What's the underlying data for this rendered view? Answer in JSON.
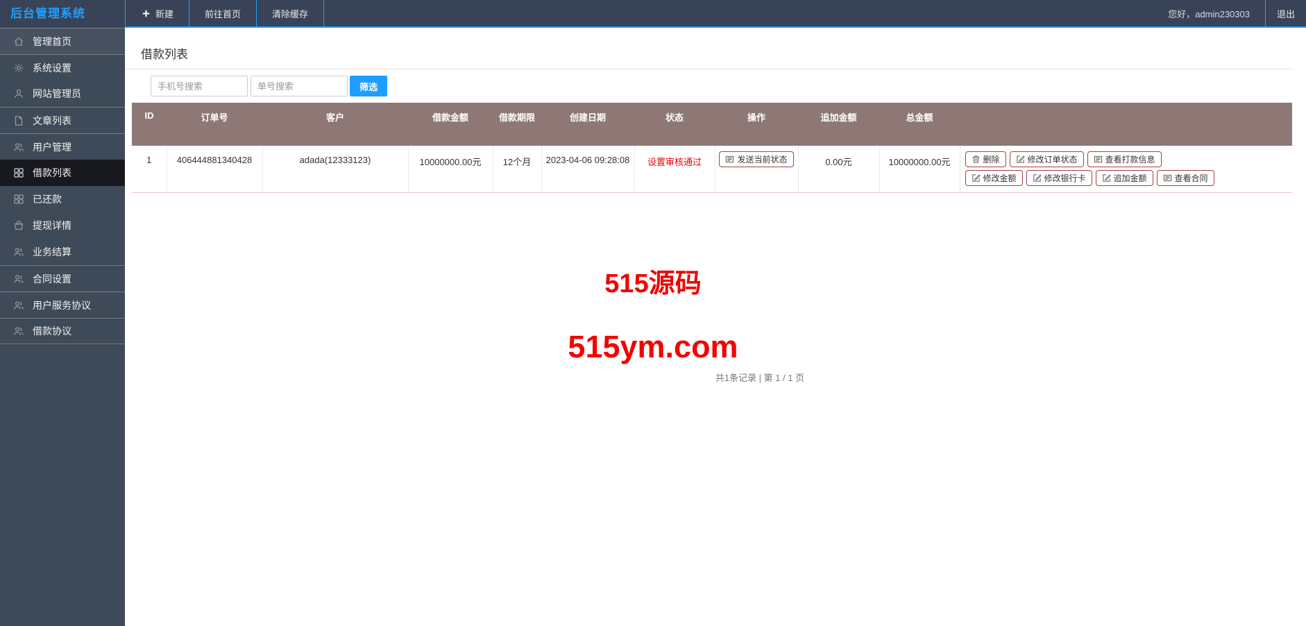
{
  "topbar": {
    "logo": "后台管理系统",
    "nav": [
      {
        "label": "新建",
        "icon": "plus-icon"
      },
      {
        "label": "前往首页"
      },
      {
        "label": "清除缓存"
      }
    ],
    "greeting": "您好，admin230303",
    "logout": "退出"
  },
  "sidebar": {
    "items": [
      {
        "label": "管理首页",
        "icon": "home-icon"
      },
      {
        "label": "系统设置",
        "icon": "gear-icon"
      },
      {
        "label": "网站管理员",
        "icon": "user-icon"
      },
      {
        "label": "文章列表",
        "icon": "document-icon"
      },
      {
        "label": "用户管理",
        "icon": "users-icon"
      },
      {
        "label": "借款列表",
        "icon": "grid-icon",
        "active": true
      },
      {
        "label": "已还款",
        "icon": "grid-icon"
      },
      {
        "label": "提现详情",
        "icon": "bag-icon"
      },
      {
        "label": "业务结算",
        "icon": "users-icon"
      },
      {
        "label": "合同设置",
        "icon": "users-icon"
      },
      {
        "label": "用户服务协议",
        "icon": "users-icon"
      },
      {
        "label": "借款协议",
        "icon": "users-icon"
      }
    ]
  },
  "page": {
    "title": "借款列表",
    "filters": {
      "phone_placeholder": "手机号搜索",
      "order_placeholder": "单号搜索",
      "filter_button": "筛选"
    },
    "table": {
      "headers": [
        "ID",
        "订单号",
        "客户",
        "借款金额",
        "借款期限",
        "创建日期",
        "状态",
        "操作",
        "追加金额",
        "总金额",
        ""
      ],
      "row": {
        "id": "1",
        "order_no": "406444881340428",
        "customer": "adada(12333123)",
        "loan_amount": "10000000.00元",
        "loan_term": "12个月",
        "created_at": "2023-04-06 09:28:08",
        "status": "设置审核通过",
        "operation_button": "发送当前状态",
        "extra_amount": "0.00元",
        "total_amount": "10000000.00元",
        "actions": [
          {
            "label": "删除",
            "icon": "trash-icon"
          },
          {
            "label": "修改订单状态",
            "icon": "edit-icon"
          },
          {
            "label": "查看打款信息",
            "icon": "list-icon"
          },
          {
            "label": "修改金额",
            "icon": "edit-icon"
          },
          {
            "label": "修改银行卡",
            "icon": "edit-icon"
          },
          {
            "label": "追加金额",
            "icon": "edit-icon"
          },
          {
            "label": "查看合同",
            "icon": "list-icon"
          }
        ]
      }
    },
    "pagination": "共1条记录 | 第 1 / 1 页"
  },
  "watermark": {
    "line1": "515源码",
    "line2": "515ym.com"
  },
  "colors": {
    "accent_blue": "#1e9fff",
    "table_header": "#8d7876",
    "action_button_border": "#a54040",
    "status_red": "#ee0000",
    "watermark_red": "#f30000",
    "sidebar_bg": "#3f4a58",
    "topbar_bg": "#394357"
  }
}
